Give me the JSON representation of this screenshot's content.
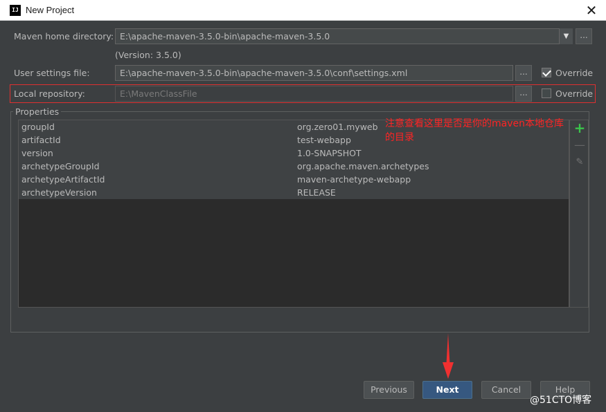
{
  "window": {
    "title": "New Project",
    "icon_text": "IJ"
  },
  "maven": {
    "home_label": "Maven home directory:",
    "home_value": "E:\\apache-maven-3.5.0-bin\\apache-maven-3.5.0",
    "version_text": "(Version: 3.5.0)",
    "settings_label": "User settings file:",
    "settings_value": "E:\\apache-maven-3.5.0-bin\\apache-maven-3.5.0\\conf\\settings.xml",
    "settings_override_label": "Override",
    "settings_override_checked": true,
    "repo_label": "Local repository:",
    "repo_value": "E:\\MavenClassFile",
    "repo_override_label": "Override",
    "repo_override_checked": false,
    "browse_label": "..."
  },
  "properties": {
    "title": "Properties",
    "rows": [
      {
        "key": "groupId",
        "value": "org.zero01.myweb"
      },
      {
        "key": "artifactId",
        "value": "test-webapp"
      },
      {
        "key": "version",
        "value": "1.0-SNAPSHOT"
      },
      {
        "key": "archetypeGroupId",
        "value": "org.apache.maven.archetypes"
      },
      {
        "key": "archetypeArtifactId",
        "value": "maven-archetype-webapp"
      },
      {
        "key": "archetypeVersion",
        "value": "RELEASE"
      }
    ]
  },
  "annotation": "注意查看这里是否是你的maven本地仓库的目录",
  "buttons": {
    "previous": "Previous",
    "next": "Next",
    "cancel": "Cancel",
    "help": "Help"
  },
  "watermark": "@51CTO博客",
  "colors": {
    "annotation": "#ff2424",
    "highlight_box": "#e03030",
    "primary_button": "#365880",
    "add_icon": "#3bc44b"
  }
}
